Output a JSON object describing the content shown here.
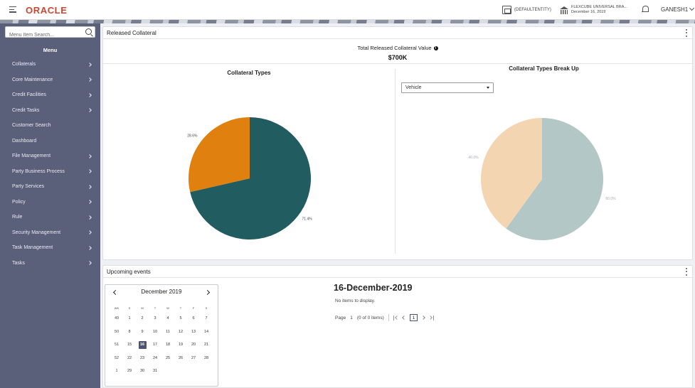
{
  "header": {
    "logo": "ORACLE",
    "entity": "(DEFAULTENTITY)",
    "branch_name": "FLEXCUBE UNIVERSAL BRA...",
    "branch_date": "December 16, 2019",
    "user": "GANESH1"
  },
  "sidebar": {
    "search_placeholder": "Menu Item Search...",
    "menu_title": "Menu",
    "items": [
      {
        "label": "Collaterals",
        "has_children": true
      },
      {
        "label": "Core Maintenance",
        "has_children": true
      },
      {
        "label": "Credit Facilities",
        "has_children": true
      },
      {
        "label": "Credit Tasks",
        "has_children": true
      },
      {
        "label": "Customer Search",
        "has_children": false
      },
      {
        "label": "Dashboard",
        "has_children": false
      },
      {
        "label": "File Management",
        "has_children": true
      },
      {
        "label": "Party Business Process",
        "has_children": true
      },
      {
        "label": "Party Services",
        "has_children": true
      },
      {
        "label": "Policy",
        "has_children": true
      },
      {
        "label": "Rule",
        "has_children": true
      },
      {
        "label": "Security Management",
        "has_children": true
      },
      {
        "label": "Task Management",
        "has_children": true
      },
      {
        "label": "Tasks",
        "has_children": true
      }
    ]
  },
  "released_collateral": {
    "title": "Released Collateral",
    "total_label": "Total Released Collateral Value",
    "total_value": "$700K",
    "dropdown_value": "Vehicle"
  },
  "chart_data": [
    {
      "type": "pie",
      "title": "Collateral Types",
      "categories": [
        "",
        ""
      ],
      "values": [
        71.4,
        28.6
      ],
      "labels": [
        "71.4%",
        "28.6%"
      ],
      "colors": [
        "#215c60",
        "#e0800f"
      ]
    },
    {
      "type": "pie",
      "title": "Collateral Types Break Up",
      "categories": [
        "",
        ""
      ],
      "values": [
        60.0,
        40.0
      ],
      "labels": [
        "60.0%",
        "40.0%"
      ],
      "colors": [
        "#b3c7c6",
        "#f4d5b1"
      ]
    }
  ],
  "events": {
    "title": "Upcoming events",
    "selected_date": "16-December-2019",
    "no_items": "No items to display.",
    "pager_page_label": "Page",
    "pager_page_num": "1",
    "pager_count": "(0 of 0 items)",
    "pager_current": "1"
  },
  "calendar": {
    "month_label": "December 2019",
    "weekday_headers": [
      "WK",
      "S",
      "M",
      "T",
      "W",
      "T",
      "F",
      "S"
    ],
    "weeks": [
      [
        "49",
        "1",
        "2",
        "3",
        "4",
        "5",
        "6",
        "7"
      ],
      [
        "50",
        "8",
        "9",
        "10",
        "11",
        "12",
        "13",
        "14"
      ],
      [
        "51",
        "15",
        "16",
        "17",
        "18",
        "19",
        "20",
        "21"
      ],
      [
        "52",
        "22",
        "23",
        "24",
        "25",
        "26",
        "27",
        "28"
      ],
      [
        "1",
        "29",
        "30",
        "31",
        "",
        "",
        "",
        ""
      ]
    ],
    "today": "16"
  }
}
